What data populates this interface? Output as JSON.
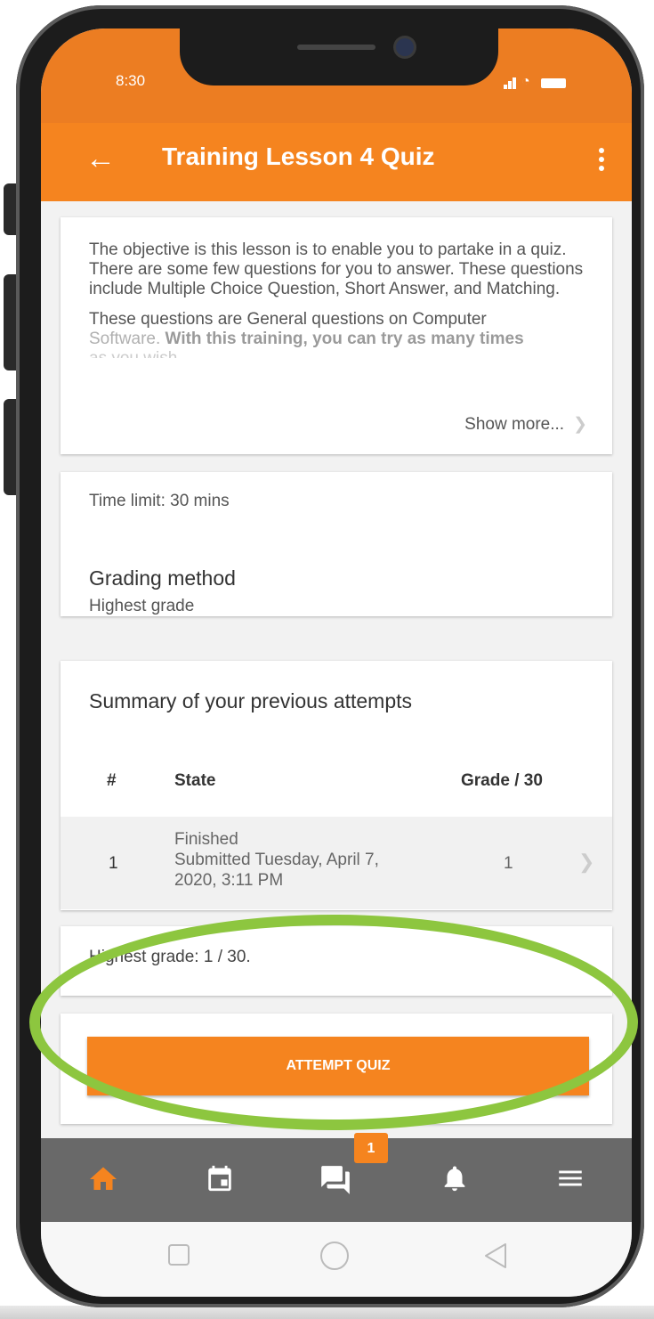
{
  "status_bar": {
    "time": "8:30"
  },
  "app_bar": {
    "title": "Training Lesson 4 Quiz"
  },
  "description": {
    "paragraph1": "The objective is this lesson is to enable you to partake in a quiz. There are some few questions for you to answer. These questions include Multiple Choice Question, Short Answer, and Matching.",
    "paragraph2_line1": "These questions are General questions on Computer",
    "paragraph2_line2_a": "Software. ",
    "paragraph2_line2_b": "With this training, you can try as many times",
    "paragraph2_line3": "as you wish.",
    "show_more": "Show more..."
  },
  "quiz_info": {
    "time_limit": "Time limit: 30 mins",
    "grading_method_label": "Grading method",
    "grading_method_value": "Highest grade"
  },
  "attempts": {
    "heading": "Summary of your previous attempts",
    "columns": [
      "#",
      "State",
      "Grade / 30"
    ],
    "rows": [
      {
        "number": "1",
        "state": "Finished",
        "submitted_line1": "Submitted Tuesday, April 7,",
        "submitted_line2": "2020, 3:11 PM",
        "grade": "1"
      }
    ]
  },
  "highest_grade": "Highest grade: 1 / 30.",
  "attempt_button": "ATTEMPT QUIZ",
  "bottom_nav": {
    "items": [
      "home-icon",
      "calendar-icon",
      "messages-icon",
      "notifications-icon",
      "menu-icon"
    ],
    "messages_badge": "1",
    "active_color": "#f5841f"
  },
  "colors": {
    "accent": "#f5841f",
    "status_bar": "#ec7d22",
    "highlight": "#8dc63f"
  }
}
